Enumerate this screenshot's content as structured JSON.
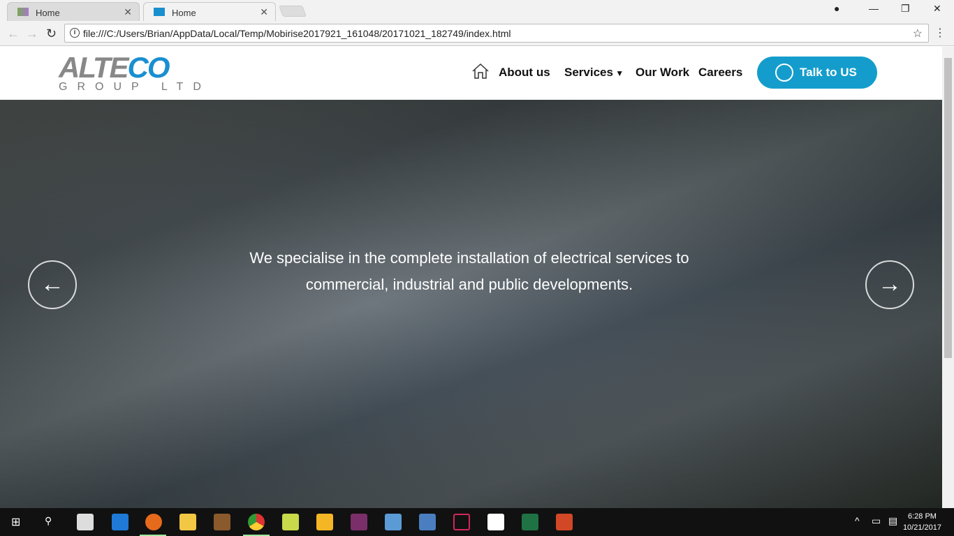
{
  "browser": {
    "tabs": [
      {
        "title": "Home"
      },
      {
        "title": "Home"
      }
    ],
    "url": "file:///C:/Users/Brian/AppData/Local/Temp/Mobirise2017921_161048/20171021_182749/index.html"
  },
  "site": {
    "logo": {
      "main_prefix": "ALTE",
      "main_suffix": "CO",
      "sub": "GROUP LTD"
    },
    "menu": [
      {
        "label": "About us"
      },
      {
        "label": "Services"
      },
      {
        "label": "Our Work"
      },
      {
        "label": "Careers"
      }
    ],
    "cta": "Talk to US",
    "accent": "#149dcc",
    "hero_caption": "We specialise in the complete installation of electrical services to commercial, industrial and public developments."
  },
  "taskbar": {
    "time": "6:28 PM",
    "date": "10/21/2017"
  }
}
